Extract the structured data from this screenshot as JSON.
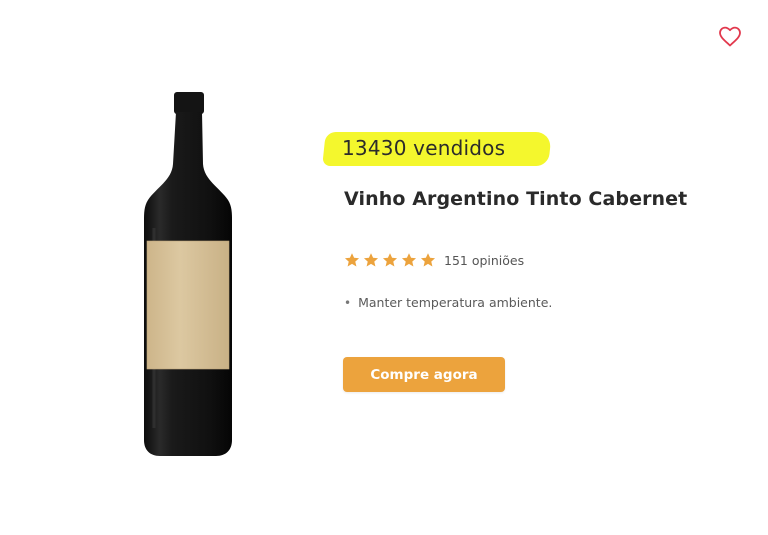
{
  "product": {
    "sold_label": "13430 vendidos",
    "title": "Vinho Argentino Tinto Cabernet",
    "rating": {
      "stars": 5,
      "max_stars": 5,
      "reviews_label": "151 opiniões"
    },
    "features": [
      "Manter temperatura ambiente."
    ],
    "buy_button_label": "Compre agora",
    "favorite_icon": "heart-outline-icon",
    "image": "wine-bottle"
  },
  "colors": {
    "highlight": "#f4f72d",
    "accent": "#eca33d",
    "star": "#eca33d",
    "heart": "#e2384d",
    "bottle": "#1a1a1a",
    "label": "#d9c39b"
  }
}
